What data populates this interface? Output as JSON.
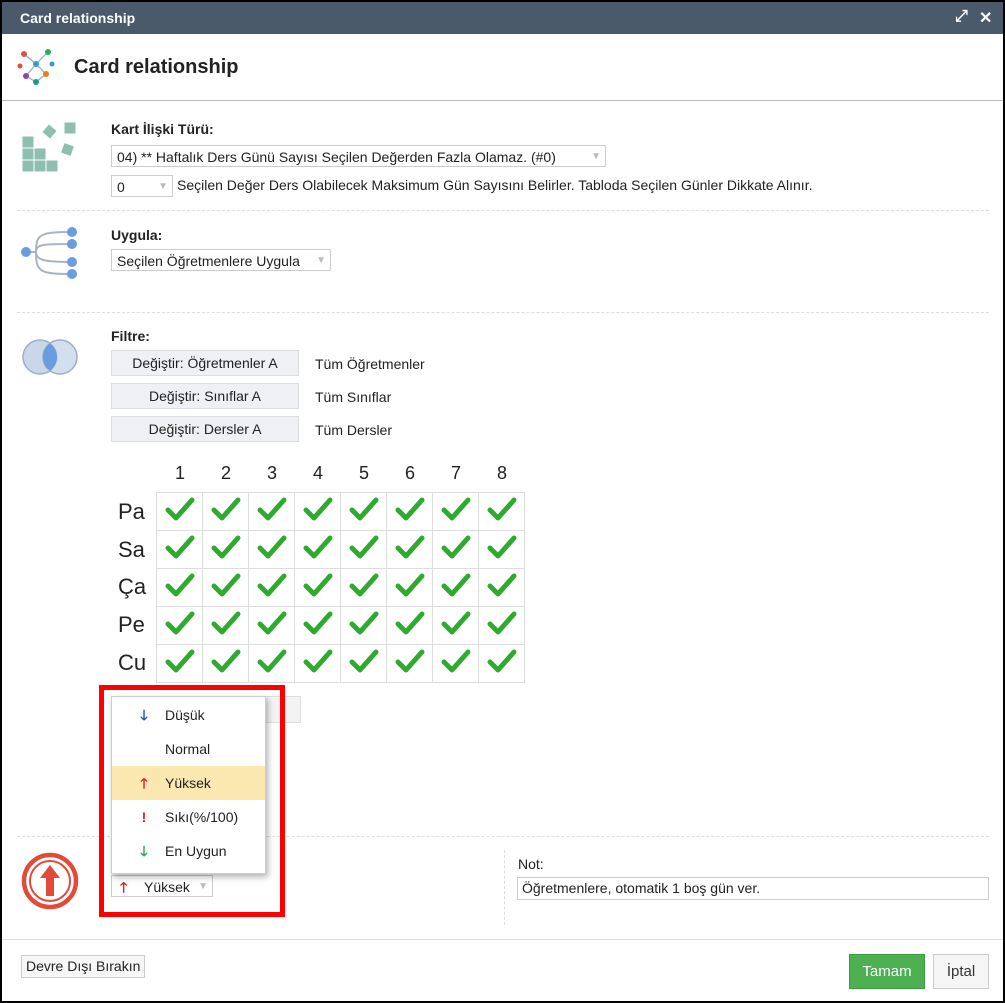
{
  "window": {
    "title": "Card relationship",
    "expand_icon": "expand-icon",
    "close_icon": "close-icon"
  },
  "header": {
    "title": "Card relationship",
    "icon": "relationship-graph-icon"
  },
  "relation_type": {
    "label": "Kart İlişki Türü:",
    "selected": "04) ** Haftalık Ders Günü Sayısı Seçilen Değerden Fazla Olamaz. (#0)",
    "value": "0",
    "value_description": "Seçilen Değer Ders Olabilecek Maksimum Gün Sayısını Belirler. Tabloda Seçilen Günler Dikkate Alınır."
  },
  "apply": {
    "label": "Uygula:",
    "selected": "Seçilen Öğretmenlere Uygula"
  },
  "filter": {
    "label": "Filtre:",
    "rows": [
      {
        "button": "Değiştir: Öğretmenler A",
        "value": "Tüm Öğretmenler"
      },
      {
        "button": "Değiştir: Sınıflar A",
        "value": "Tüm Sınıflar"
      },
      {
        "button": "Değiştir: Dersler A",
        "value": "Tüm Dersler"
      }
    ]
  },
  "schedule": {
    "columns": [
      "1",
      "2",
      "3",
      "4",
      "5",
      "6",
      "7",
      "8"
    ],
    "rows": [
      "Pa",
      "Sa",
      "Ça",
      "Pe",
      "Cu"
    ],
    "all_checked": true,
    "check_color": "#2eaa2e"
  },
  "importance_menu": {
    "items": [
      {
        "label": "Düşük",
        "icon": "arrow-down-icon",
        "color": "#2244cc"
      },
      {
        "label": "Normal",
        "icon": "",
        "color": ""
      },
      {
        "label": "Yüksek",
        "icon": "arrow-up-icon",
        "color": "#e02020",
        "highlighted": true
      },
      {
        "label": "Sıkı(%/100)",
        "icon": "exclamation-icon",
        "color": "#e02020"
      },
      {
        "label": "En Uygun",
        "icon": "arrow-down-icon",
        "color": "#22aa55"
      }
    ],
    "selected": "Yüksek"
  },
  "note": {
    "label": "Not:",
    "value": "Öğretmenlere, otomatik 1 boş gün ver."
  },
  "footer": {
    "disable": "Devre Dışı Bırakın",
    "ok": "Tamam",
    "cancel": "İptal"
  },
  "colors": {
    "titlebar": "#4a5a6a",
    "highlight": "#fbe8b0",
    "ok": "#4caf50",
    "callout": "#ff0000"
  }
}
